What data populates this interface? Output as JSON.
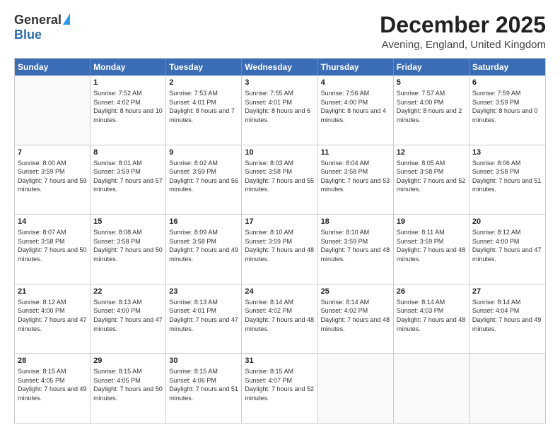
{
  "logo": {
    "general": "General",
    "blue": "Blue"
  },
  "title": "December 2025",
  "location": "Avening, England, United Kingdom",
  "days": [
    "Sunday",
    "Monday",
    "Tuesday",
    "Wednesday",
    "Thursday",
    "Friday",
    "Saturday"
  ],
  "rows": [
    [
      {
        "day": "",
        "empty": true
      },
      {
        "day": "1",
        "sunrise": "7:52 AM",
        "sunset": "4:02 PM",
        "daylight": "8 hours and 10 minutes."
      },
      {
        "day": "2",
        "sunrise": "7:53 AM",
        "sunset": "4:01 PM",
        "daylight": "8 hours and 7 minutes."
      },
      {
        "day": "3",
        "sunrise": "7:55 AM",
        "sunset": "4:01 PM",
        "daylight": "8 hours and 6 minutes."
      },
      {
        "day": "4",
        "sunrise": "7:56 AM",
        "sunset": "4:00 PM",
        "daylight": "8 hours and 4 minutes."
      },
      {
        "day": "5",
        "sunrise": "7:57 AM",
        "sunset": "4:00 PM",
        "daylight": "8 hours and 2 minutes."
      },
      {
        "day": "6",
        "sunrise": "7:59 AM",
        "sunset": "3:59 PM",
        "daylight": "8 hours and 0 minutes."
      }
    ],
    [
      {
        "day": "7",
        "sunrise": "8:00 AM",
        "sunset": "3:59 PM",
        "daylight": "7 hours and 59 minutes."
      },
      {
        "day": "8",
        "sunrise": "8:01 AM",
        "sunset": "3:59 PM",
        "daylight": "7 hours and 57 minutes."
      },
      {
        "day": "9",
        "sunrise": "8:02 AM",
        "sunset": "3:59 PM",
        "daylight": "7 hours and 56 minutes."
      },
      {
        "day": "10",
        "sunrise": "8:03 AM",
        "sunset": "3:58 PM",
        "daylight": "7 hours and 55 minutes."
      },
      {
        "day": "11",
        "sunrise": "8:04 AM",
        "sunset": "3:58 PM",
        "daylight": "7 hours and 53 minutes."
      },
      {
        "day": "12",
        "sunrise": "8:05 AM",
        "sunset": "3:58 PM",
        "daylight": "7 hours and 52 minutes."
      },
      {
        "day": "13",
        "sunrise": "8:06 AM",
        "sunset": "3:58 PM",
        "daylight": "7 hours and 51 minutes."
      }
    ],
    [
      {
        "day": "14",
        "sunrise": "8:07 AM",
        "sunset": "3:58 PM",
        "daylight": "7 hours and 50 minutes."
      },
      {
        "day": "15",
        "sunrise": "8:08 AM",
        "sunset": "3:58 PM",
        "daylight": "7 hours and 50 minutes."
      },
      {
        "day": "16",
        "sunrise": "8:09 AM",
        "sunset": "3:58 PM",
        "daylight": "7 hours and 49 minutes."
      },
      {
        "day": "17",
        "sunrise": "8:10 AM",
        "sunset": "3:59 PM",
        "daylight": "7 hours and 48 minutes."
      },
      {
        "day": "18",
        "sunrise": "8:10 AM",
        "sunset": "3:59 PM",
        "daylight": "7 hours and 48 minutes."
      },
      {
        "day": "19",
        "sunrise": "8:11 AM",
        "sunset": "3:59 PM",
        "daylight": "7 hours and 48 minutes."
      },
      {
        "day": "20",
        "sunrise": "8:12 AM",
        "sunset": "4:00 PM",
        "daylight": "7 hours and 47 minutes."
      }
    ],
    [
      {
        "day": "21",
        "sunrise": "8:12 AM",
        "sunset": "4:00 PM",
        "daylight": "7 hours and 47 minutes."
      },
      {
        "day": "22",
        "sunrise": "8:13 AM",
        "sunset": "4:00 PM",
        "daylight": "7 hours and 47 minutes."
      },
      {
        "day": "23",
        "sunrise": "8:13 AM",
        "sunset": "4:01 PM",
        "daylight": "7 hours and 47 minutes."
      },
      {
        "day": "24",
        "sunrise": "8:14 AM",
        "sunset": "4:02 PM",
        "daylight": "7 hours and 48 minutes."
      },
      {
        "day": "25",
        "sunrise": "8:14 AM",
        "sunset": "4:02 PM",
        "daylight": "7 hours and 48 minutes."
      },
      {
        "day": "26",
        "sunrise": "8:14 AM",
        "sunset": "4:03 PM",
        "daylight": "7 hours and 48 minutes."
      },
      {
        "day": "27",
        "sunrise": "8:14 AM",
        "sunset": "4:04 PM",
        "daylight": "7 hours and 49 minutes."
      }
    ],
    [
      {
        "day": "28",
        "sunrise": "8:15 AM",
        "sunset": "4:05 PM",
        "daylight": "7 hours and 49 minutes."
      },
      {
        "day": "29",
        "sunrise": "8:15 AM",
        "sunset": "4:05 PM",
        "daylight": "7 hours and 50 minutes."
      },
      {
        "day": "30",
        "sunrise": "8:15 AM",
        "sunset": "4:06 PM",
        "daylight": "7 hours and 51 minutes."
      },
      {
        "day": "31",
        "sunrise": "8:15 AM",
        "sunset": "4:07 PM",
        "daylight": "7 hours and 52 minutes."
      },
      {
        "day": "",
        "empty": true
      },
      {
        "day": "",
        "empty": true
      },
      {
        "day": "",
        "empty": true
      }
    ]
  ]
}
